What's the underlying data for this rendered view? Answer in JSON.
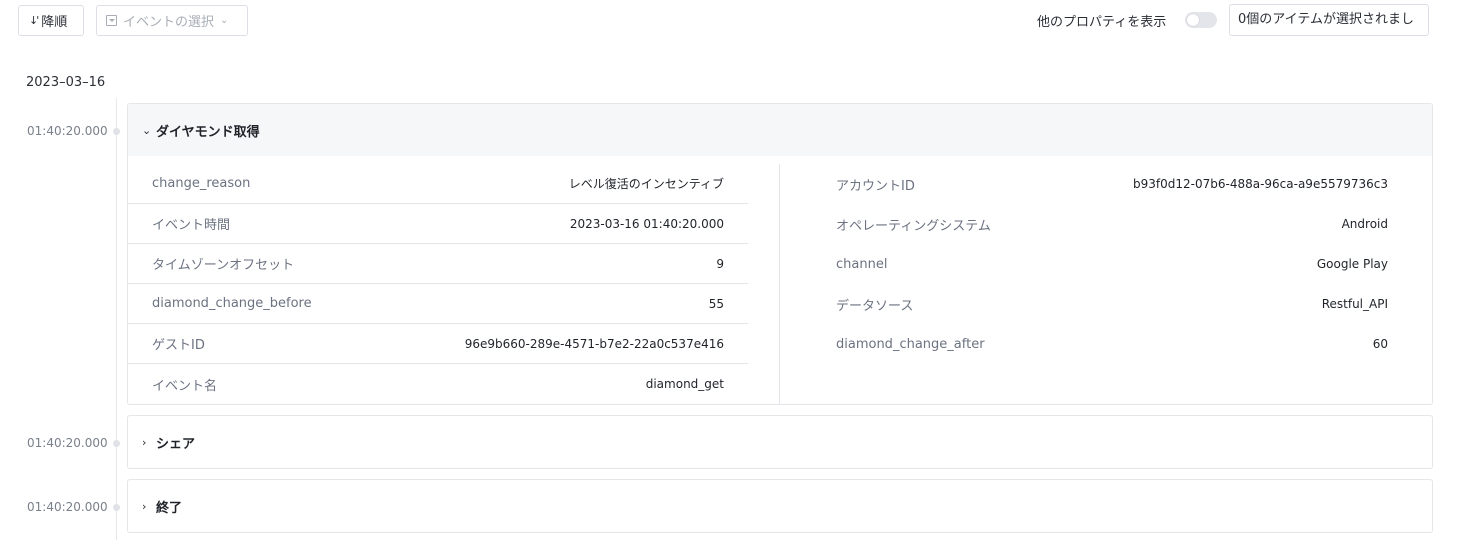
{
  "toolbar": {
    "sort_label": "降順",
    "sort_icon": "sort-icon",
    "event_select_placeholder": "イベントの選択",
    "show_other_props_label": "他のプロパティを表示",
    "show_other_props_on": false,
    "selected_items_text": "0個のアイテムが選択されまし"
  },
  "timeline": {
    "date": "2023–03–16",
    "events": [
      {
        "time": "01:40:20.000",
        "title": "ダイヤモンド取得",
        "expanded": true,
        "left_properties": [
          {
            "key": "change_reason",
            "value": "レベル復活のインセンティブ"
          },
          {
            "key": "イベント時間",
            "value": "2023-03-16 01:40:20.000"
          },
          {
            "key": "タイムゾーンオフセット",
            "value": "9"
          },
          {
            "key": "diamond_change_before",
            "value": "55"
          },
          {
            "key": "ゲストID",
            "value": "96e9b660-289e-4571-b7e2-22a0c537e416"
          },
          {
            "key": "イベント名",
            "value": "diamond_get"
          }
        ],
        "right_properties": [
          {
            "key": "アカウントID",
            "value": "b93f0d12-07b6-488a-96ca-a9e5579736c3"
          },
          {
            "key": "オペレーティングシステム",
            "value": "Android"
          },
          {
            "key": "channel",
            "value": "Google Play"
          },
          {
            "key": "データソース",
            "value": "Restful_API"
          },
          {
            "key": "diamond_change_after",
            "value": "60"
          }
        ]
      },
      {
        "time": "01:40:20.000",
        "title": "シェア",
        "expanded": false
      },
      {
        "time": "01:40:20.000",
        "title": "終了",
        "expanded": false
      }
    ]
  }
}
